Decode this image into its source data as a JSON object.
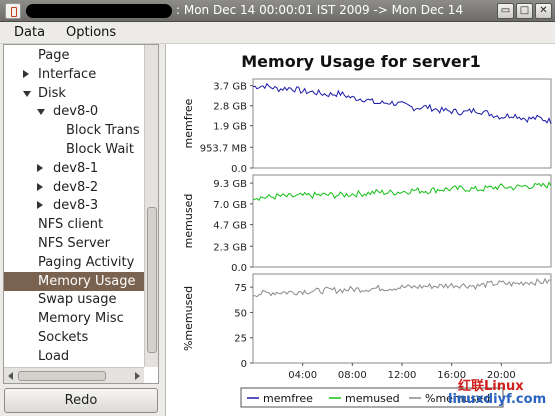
{
  "window": {
    "title": ": Mon Dec 14 00:00:01 IST 2009 -> Mon Dec 14",
    "controls": [
      "▭",
      "□",
      "✕"
    ]
  },
  "menu": [
    "Data",
    "Options"
  ],
  "tree": [
    {
      "label": "Page",
      "level": 1,
      "expander": "none",
      "selected": false
    },
    {
      "label": "Interface",
      "level": 1,
      "expander": "collapsed",
      "selected": false
    },
    {
      "label": "Disk",
      "level": 1,
      "expander": "expanded",
      "selected": false
    },
    {
      "label": "dev8-0",
      "level": 2,
      "expander": "expanded",
      "selected": false
    },
    {
      "label": "Block Trans",
      "level": 3,
      "expander": "none",
      "selected": false
    },
    {
      "label": "Block Wait",
      "level": 3,
      "expander": "none",
      "selected": false
    },
    {
      "label": "dev8-1",
      "level": 2,
      "expander": "collapsed",
      "selected": false
    },
    {
      "label": "dev8-2",
      "level": 2,
      "expander": "collapsed",
      "selected": false
    },
    {
      "label": "dev8-3",
      "level": 2,
      "expander": "collapsed",
      "selected": false
    },
    {
      "label": "NFS client",
      "level": 1,
      "expander": "none",
      "selected": false
    },
    {
      "label": "NFS Server",
      "level": 1,
      "expander": "none",
      "selected": false
    },
    {
      "label": "Paging Activity",
      "level": 1,
      "expander": "none",
      "selected": false
    },
    {
      "label": "Memory Usage",
      "level": 1,
      "expander": "none",
      "selected": true
    },
    {
      "label": "Swap usage",
      "level": 1,
      "expander": "none",
      "selected": false
    },
    {
      "label": "Memory Misc",
      "level": 1,
      "expander": "none",
      "selected": false
    },
    {
      "label": "Sockets",
      "level": 1,
      "expander": "none",
      "selected": false
    },
    {
      "label": "Load",
      "level": 1,
      "expander": "none",
      "selected": false
    }
  ],
  "redo_label": "Redo",
  "watermark": {
    "line1": "红联Linux",
    "line2": "linuxdiyf.com"
  },
  "chart_data": {
    "type": "line",
    "title": "Memory Usage for server1",
    "x_ticks": [
      "04:00",
      "08:00",
      "12:00",
      "16:00",
      "20:00"
    ],
    "x_tick_hours": [
      4,
      8,
      12,
      16,
      20
    ],
    "x_range_hours": [
      0,
      24
    ],
    "grid": false,
    "legend_position": "bottom",
    "legend": [
      "memfree",
      "memused",
      "%memused"
    ],
    "panels": [
      {
        "ylabel": "memfree",
        "color": "#1a1aa8",
        "y_ticks": [
          "3.7 GB",
          "2.8 GB",
          "1.9 GB",
          "953.7 MB",
          "0.0"
        ],
        "y_tick_values_gb": [
          3.7,
          2.8,
          1.9,
          0.93,
          0.0
        ],
        "ylim_gb": [
          0,
          4.0
        ],
        "series": {
          "name": "memfree",
          "hours": [
            0,
            1,
            2,
            3,
            4,
            5,
            6,
            7,
            8,
            9,
            10,
            11,
            12,
            13,
            14,
            15,
            16,
            17,
            18,
            19,
            20,
            21,
            22,
            23,
            24
          ],
          "values_gb": [
            3.65,
            3.7,
            3.55,
            3.6,
            3.45,
            3.4,
            3.3,
            3.35,
            3.15,
            3.1,
            2.9,
            2.95,
            2.85,
            2.7,
            2.75,
            2.6,
            2.55,
            2.5,
            2.6,
            2.45,
            2.3,
            2.4,
            2.2,
            2.25,
            2.1
          ]
        }
      },
      {
        "ylabel": "memused",
        "color": "#15c015",
        "y_ticks": [
          "9.3 GB",
          "7.0 GB",
          "4.7 GB",
          "2.3 GB",
          "0.0"
        ],
        "y_tick_values_gb": [
          9.3,
          7.0,
          4.7,
          2.3,
          0.0
        ],
        "ylim_gb": [
          0,
          10.2
        ],
        "series": {
          "name": "memused",
          "hours": [
            0,
            1,
            2,
            3,
            4,
            5,
            6,
            7,
            8,
            9,
            10,
            11,
            12,
            13,
            14,
            15,
            16,
            17,
            18,
            19,
            20,
            21,
            22,
            23,
            24
          ],
          "values_gb": [
            7.75,
            7.7,
            7.85,
            7.8,
            7.9,
            7.95,
            8.0,
            7.95,
            8.1,
            8.15,
            8.3,
            8.25,
            8.35,
            8.5,
            8.45,
            8.6,
            8.65,
            8.7,
            8.6,
            8.75,
            8.9,
            8.8,
            9.0,
            8.95,
            9.1
          ]
        }
      },
      {
        "ylabel": "%memused",
        "color": "#8a8a8a",
        "y_ticks": [
          "75",
          "50",
          "25",
          "0"
        ],
        "y_tick_values": [
          75,
          50,
          25,
          0
        ],
        "ylim": [
          0,
          88
        ],
        "series": {
          "name": "%memused",
          "hours": [
            0,
            1,
            2,
            3,
            4,
            5,
            6,
            7,
            8,
            9,
            10,
            11,
            12,
            13,
            14,
            15,
            16,
            17,
            18,
            19,
            20,
            21,
            22,
            23,
            24
          ],
          "values": [
            68,
            69,
            70,
            70,
            71,
            71,
            72,
            72,
            73,
            73,
            74,
            74,
            75,
            75,
            76,
            76,
            77,
            77,
            76,
            78,
            79,
            78,
            80,
            80,
            81
          ]
        }
      }
    ]
  }
}
